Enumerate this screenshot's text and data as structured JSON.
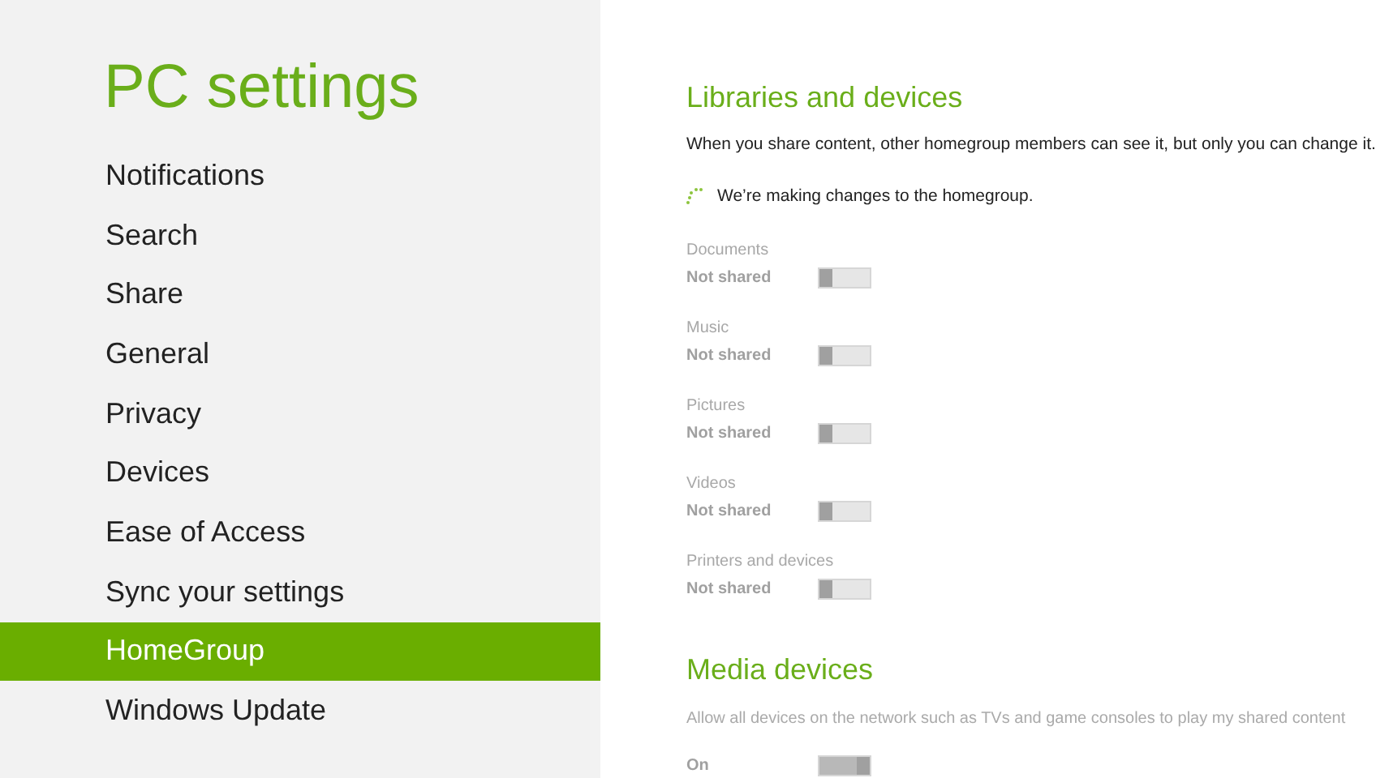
{
  "sidebar": {
    "title": "PC settings",
    "items": [
      {
        "label": "Notifications",
        "selected": false
      },
      {
        "label": "Search",
        "selected": false
      },
      {
        "label": "Share",
        "selected": false
      },
      {
        "label": "General",
        "selected": false
      },
      {
        "label": "Privacy",
        "selected": false
      },
      {
        "label": "Devices",
        "selected": false
      },
      {
        "label": "Ease of Access",
        "selected": false
      },
      {
        "label": "Sync your settings",
        "selected": false
      },
      {
        "label": "HomeGroup",
        "selected": true
      },
      {
        "label": "Windows Update",
        "selected": false
      }
    ]
  },
  "libraries": {
    "heading": "Libraries and devices",
    "description": "When you share content, other homegroup members can see it, but only you can change it.",
    "status": "We’re making changes to the homegroup.",
    "items": [
      {
        "name": "Documents",
        "state": "Not shared",
        "on": false
      },
      {
        "name": "Music",
        "state": "Not shared",
        "on": false
      },
      {
        "name": "Pictures",
        "state": "Not shared",
        "on": false
      },
      {
        "name": "Videos",
        "state": "Not shared",
        "on": false
      },
      {
        "name": "Printers and devices",
        "state": "Not shared",
        "on": false
      }
    ]
  },
  "media": {
    "heading": "Media devices",
    "description": "Allow all devices on the network such as TVs and game consoles to play my shared content",
    "state": "On",
    "on": true
  }
}
